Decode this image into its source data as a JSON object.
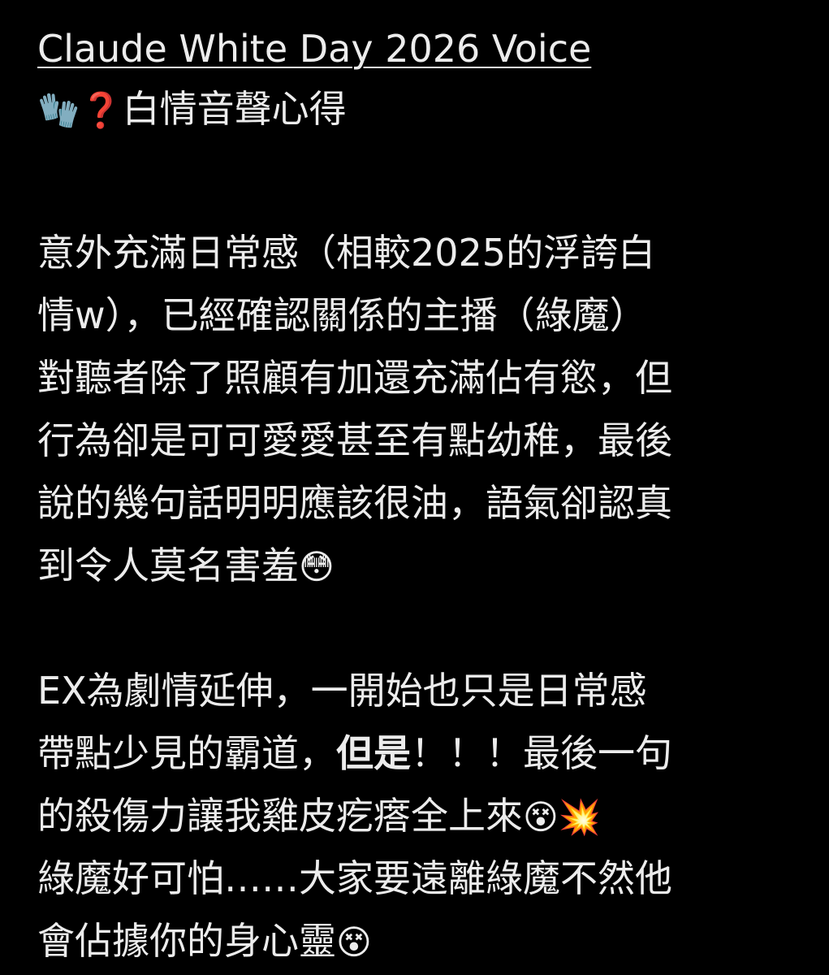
{
  "post": {
    "title": "Claude White Day 2026 Voice",
    "subtitle": {
      "emoji_gloves": "🧤",
      "emoji_question": "❓",
      "text": "白情音聲心得"
    },
    "paragraph_1": {
      "line_1": "意外充滿日常感（相較2025的浮誇白",
      "line_2": "情w），已經確認關係的主播（綠魔）",
      "line_3": "對聽者除了照顧有加還充滿佔有慾，但",
      "line_4": "行為卻是可可愛愛甚至有點幼稚，最後",
      "line_5": "說的幾句話明明應該很油，語氣卻認真",
      "line_6": "到令人莫名害羞",
      "line_6_emoji": "😳"
    },
    "paragraph_2": {
      "line_1": "EX為劇情延伸，一開始也只是日常感",
      "line_2_prefix": "帶點少見的霸道，",
      "line_2_bold": "但是",
      "line_2_suffix": "！！！最後一句",
      "line_3": "的殺傷力讓我雞皮疙瘩全上來",
      "line_3_emoji_1": "😵",
      "line_3_emoji_2": "💥",
      "line_4": "綠魔好可怕……大家要遠離綠魔不然他",
      "line_5": "會佔據你的身心靈",
      "line_5_emoji": "😵"
    }
  }
}
